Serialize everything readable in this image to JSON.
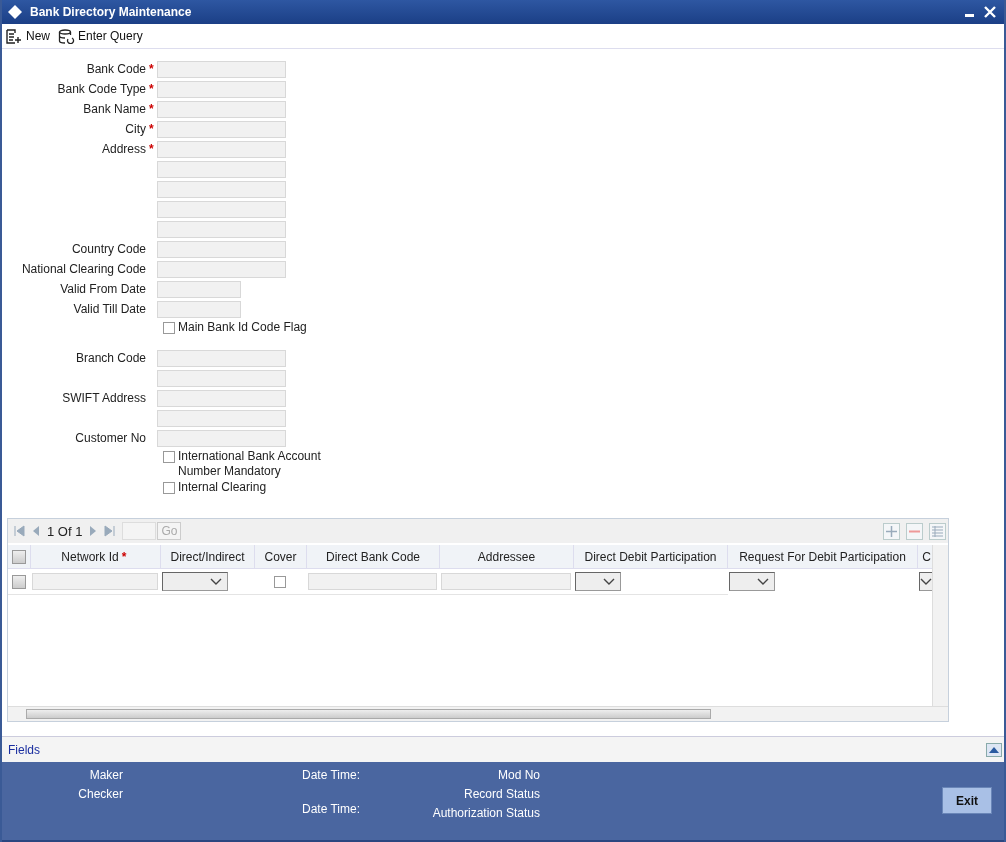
{
  "window": {
    "title": "Bank Directory Maintenance"
  },
  "toolbar": [
    {
      "label": "New",
      "kind": "new"
    },
    {
      "label": "Enter Query",
      "kind": "query"
    }
  ],
  "form": [
    {
      "kind": "field",
      "label": "Bank Code",
      "mark": "*"
    },
    {
      "kind": "field",
      "label": "Bank Code Type",
      "mark": "*"
    },
    {
      "kind": "field",
      "label": "Bank Name",
      "mark": "*"
    },
    {
      "kind": "field",
      "label": "City",
      "mark": "*"
    },
    {
      "kind": "field",
      "label": "Address",
      "mark": "*"
    },
    {
      "kind": "field"
    },
    {
      "kind": "field"
    },
    {
      "kind": "field"
    },
    {
      "kind": "field"
    },
    {
      "kind": "field",
      "label": "Country Code"
    },
    {
      "kind": "field",
      "label": "National Clearing Code"
    },
    {
      "kind": "date",
      "label": "Valid From Date"
    },
    {
      "kind": "date",
      "label": "Valid Till Date"
    },
    {
      "kind": "checkbox",
      "label": "Main Bank Id Code Flag",
      "checked": false
    },
    {
      "kind": "gap"
    },
    {
      "kind": "field",
      "label": "Branch Code"
    },
    {
      "kind": "field"
    },
    {
      "kind": "field",
      "label": "SWIFT Address"
    },
    {
      "kind": "field"
    },
    {
      "kind": "field",
      "label": "Customer No"
    },
    {
      "kind": "checkbox",
      "label": "International Bank Account Number Mandatory",
      "checked": false
    },
    {
      "kind": "checkbox",
      "label": "Internal Clearing",
      "checked": false
    }
  ],
  "grid": {
    "pager": {
      "page": "1 Of 1",
      "go": "Go"
    },
    "select_all_checked": false,
    "columns": [
      {
        "label": "Network Id",
        "mark": "*",
        "kind": "text"
      },
      {
        "label": "Direct/Indirect",
        "kind": "select"
      },
      {
        "label": "Cover",
        "kind": "checkbox"
      },
      {
        "label": "Direct Bank Code",
        "kind": "text"
      },
      {
        "label": "Addressee",
        "kind": "text"
      },
      {
        "label": "Direct Debit Participation",
        "kind": "select"
      },
      {
        "label": "Request For Debit Participation",
        "kind": "select"
      },
      {
        "label": "C",
        "kind": "select"
      }
    ],
    "rows": [
      {
        "checked": false,
        "cover": false
      }
    ]
  },
  "fields_bar": {
    "label": "Fields"
  },
  "footer": {
    "col1": [
      "Maker",
      "Checker"
    ],
    "col2": [
      "Date Time:",
      "Date Time:"
    ],
    "col3": [
      "Mod No",
      "Record Status",
      "Authorization Status"
    ],
    "exit": "Exit"
  }
}
